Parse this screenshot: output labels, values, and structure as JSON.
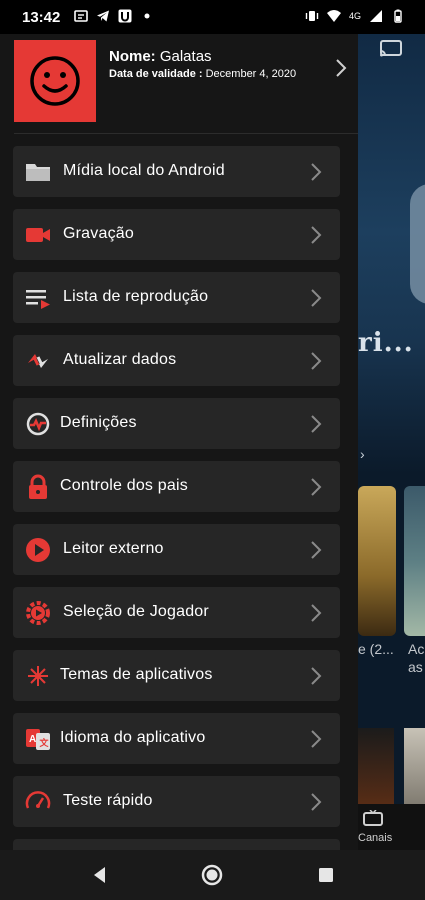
{
  "status_bar": {
    "time": "13:42",
    "network_label": "4G",
    "left_icons": [
      "message-icon",
      "telegram-icon",
      "u-app-icon",
      "dot-icon"
    ],
    "right_icons": [
      "vibrate-icon",
      "wifi-icon",
      "signal-icon",
      "battery-icon"
    ]
  },
  "drawer": {
    "profile": {
      "name_label": "Nome:",
      "name_value": "Galatas",
      "expiry_label": "Data de validade :",
      "expiry_value": "December 4, 2020",
      "avatar_icon": "smiley-face-icon"
    },
    "menu_items": [
      {
        "label": "Mídia local do Android",
        "icon": "folder-icon",
        "color": "#e0e0e0"
      },
      {
        "label": "Gravação",
        "icon": "video-camera-icon",
        "color": "#e53935"
      },
      {
        "label": "Lista de reprodução",
        "icon": "playlist-icon",
        "color": "#e53935"
      },
      {
        "label": "Atualizar dados",
        "icon": "refresh-arrows-icon",
        "color": "#e53935"
      },
      {
        "label": "Definições",
        "icon": "settings-gauge-icon",
        "color": "#e53935"
      },
      {
        "label": "Controle dos pais",
        "icon": "lock-icon",
        "color": "#e53935"
      },
      {
        "label": "Leitor externo",
        "icon": "play-circle-icon",
        "color": "#e53935"
      },
      {
        "label": "Seleção de Jogador",
        "icon": "player-gear-icon",
        "color": "#e53935"
      },
      {
        "label": "Temas de aplicativos",
        "icon": "theme-burst-icon",
        "color": "#e53935"
      },
      {
        "label": "Idioma do aplicativo",
        "icon": "language-icon",
        "color": "#e53935"
      },
      {
        "label": "Teste rápido",
        "icon": "speedometer-icon",
        "color": "#e53935"
      }
    ]
  },
  "background_app": {
    "title_fragment": "ri...",
    "card_captions": [
      "e (2...",
      "Ac as"
    ],
    "nav_label": "Canais"
  },
  "colors": {
    "accent": "#e53935",
    "drawer_bg": "#161616",
    "item_bg": "#262626"
  }
}
